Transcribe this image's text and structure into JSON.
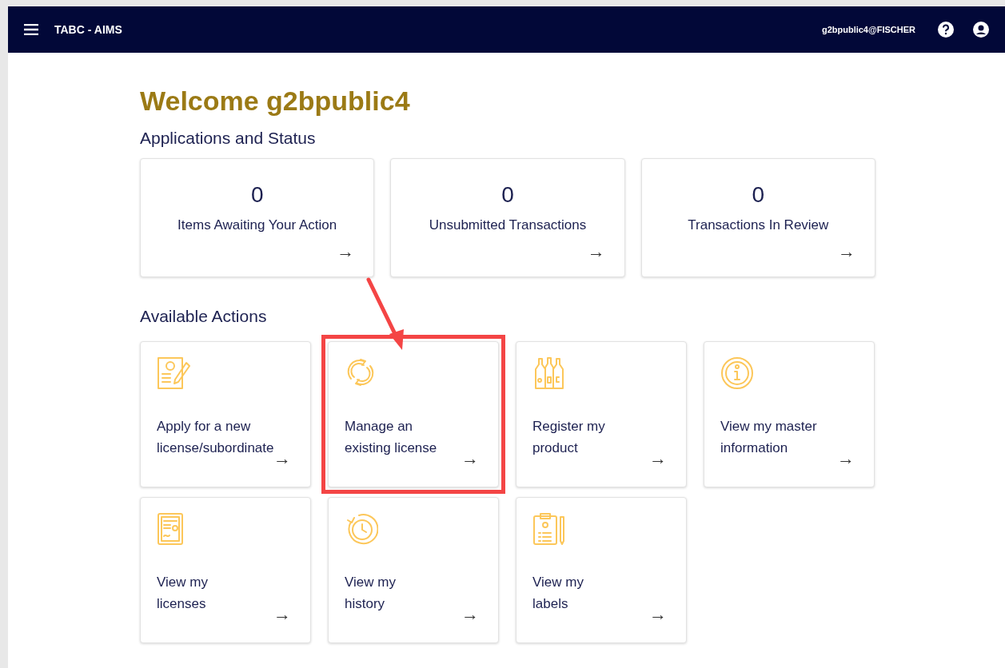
{
  "navbar": {
    "title": "TABC - AIMS",
    "user": "g2bpublic4@FISCHER"
  },
  "welcome": "Welcome g2bpublic4",
  "status_heading": "Applications and Status",
  "status_cards": [
    {
      "count": "0",
      "label": "Items Awaiting Your Action",
      "arrow": "→"
    },
    {
      "count": "0",
      "label": "Unsubmitted Transactions",
      "arrow": "→"
    },
    {
      "count": "0",
      "label": "Transactions In Review",
      "arrow": "→"
    }
  ],
  "actions_heading": "Available Actions",
  "callout_arrow": true,
  "actions": [
    {
      "kind": "application",
      "lines": [
        "Apply for a new",
        "license/subordinate"
      ],
      "arrow": "→",
      "highlighted": false
    },
    {
      "kind": "renew",
      "lines": [
        "Manage an",
        "existing license"
      ],
      "arrow": "→",
      "highlighted": true
    },
    {
      "kind": "bottles",
      "lines": [
        "Register my",
        "product"
      ],
      "arrow": "→",
      "highlighted": false
    },
    {
      "kind": "info",
      "lines": [
        "View my master",
        "information"
      ],
      "arrow": "→",
      "highlighted": false
    },
    {
      "kind": "certificate",
      "lines": [
        "View my",
        "licenses"
      ],
      "arrow": "→",
      "highlighted": false
    },
    {
      "kind": "history",
      "lines": [
        "View my",
        "history"
      ],
      "arrow": "→",
      "highlighted": false
    },
    {
      "kind": "clipboard",
      "lines": [
        "View my",
        "labels"
      ],
      "arrow": "→",
      "highlighted": false
    }
  ]
}
